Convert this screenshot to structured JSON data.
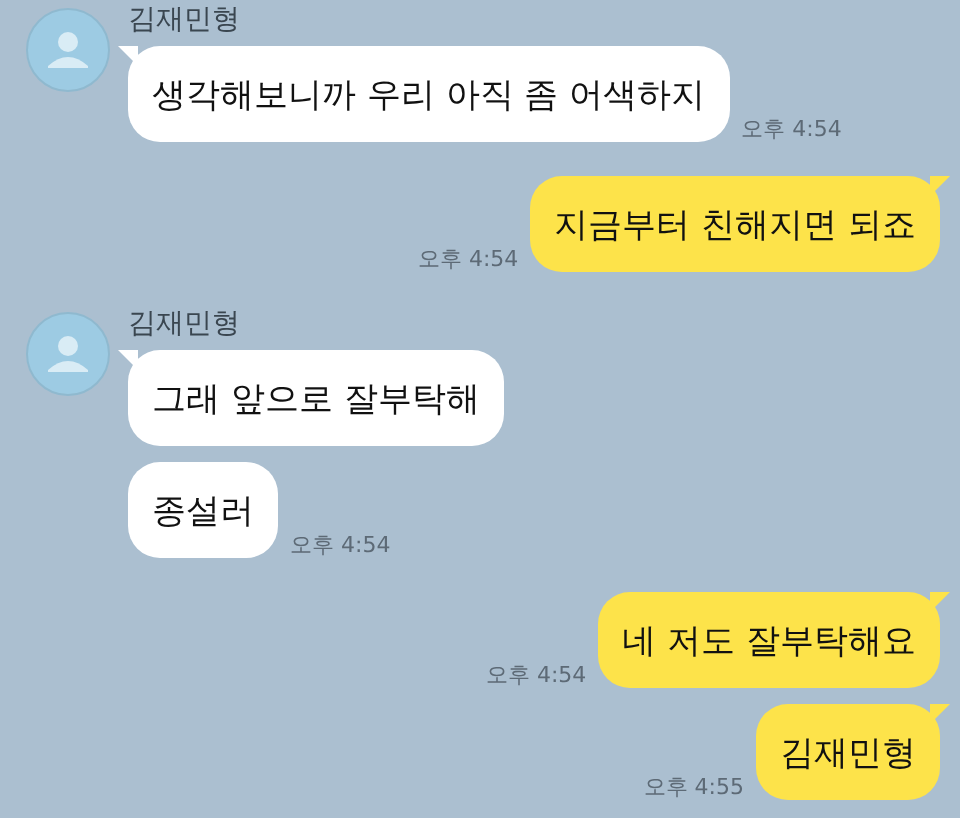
{
  "chat": [
    {
      "kind": "received",
      "sender": "김재민형",
      "messages": [
        {
          "text": "생각해보니까 우리 아직 좀 어색하지",
          "time": "오후 4:54"
        }
      ]
    },
    {
      "kind": "sent",
      "messages": [
        {
          "text": "지금부터 친해지면 되죠",
          "time": "오후 4:54"
        }
      ]
    },
    {
      "kind": "received",
      "sender": "김재민형",
      "messages": [
        {
          "text": "그래 앞으로 잘부탁해"
        },
        {
          "text": "종설러",
          "time": "오후 4:54"
        }
      ]
    },
    {
      "kind": "sent",
      "messages": [
        {
          "text": "네 저도 잘부탁해요",
          "time": "오후 4:54"
        },
        {
          "text": "김재민형",
          "time": "오후 4:55"
        }
      ]
    }
  ]
}
